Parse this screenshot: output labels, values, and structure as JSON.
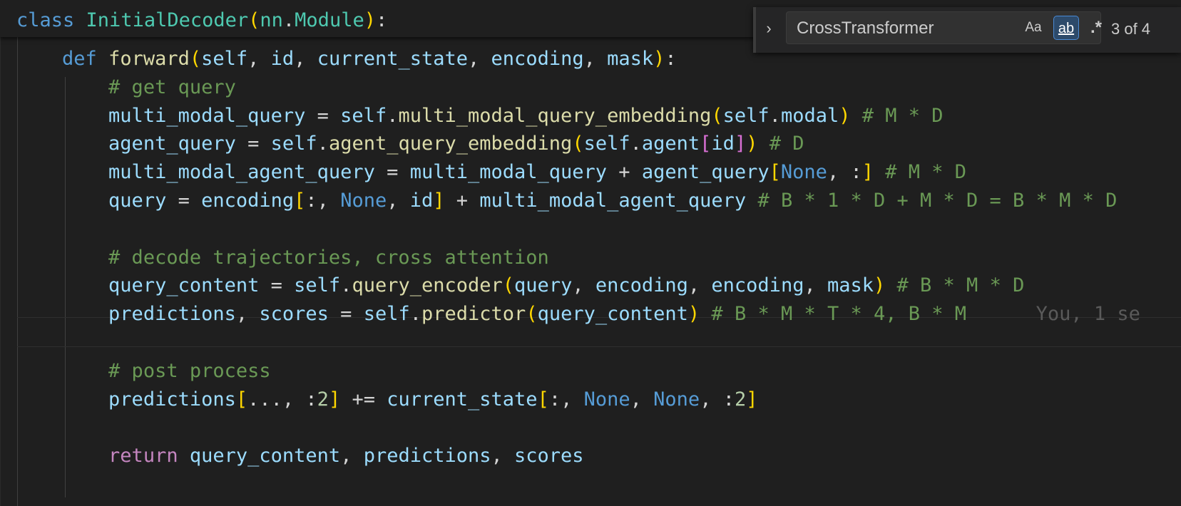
{
  "sticky_header": [
    {
      "t": "class ",
      "c": "kw"
    },
    {
      "t": "InitialDecoder",
      "c": "cls"
    },
    {
      "t": "(",
      "c": "br1"
    },
    {
      "t": "nn",
      "c": "cls"
    },
    {
      "t": ".",
      "c": "txt"
    },
    {
      "t": "Module",
      "c": "cls"
    },
    {
      "t": ")",
      "c": "br1"
    },
    {
      "t": ":",
      "c": "txt"
    }
  ],
  "code_lines": [
    [
      {
        "t": "    ",
        "c": "txt"
      },
      {
        "t": "def ",
        "c": "kw"
      },
      {
        "t": "forward",
        "c": "fn"
      },
      {
        "t": "(",
        "c": "br1"
      },
      {
        "t": "self",
        "c": "var"
      },
      {
        "t": ", ",
        "c": "txt"
      },
      {
        "t": "id",
        "c": "var"
      },
      {
        "t": ", ",
        "c": "txt"
      },
      {
        "t": "current_state",
        "c": "var"
      },
      {
        "t": ", ",
        "c": "txt"
      },
      {
        "t": "encoding",
        "c": "var"
      },
      {
        "t": ", ",
        "c": "txt"
      },
      {
        "t": "mask",
        "c": "var"
      },
      {
        "t": ")",
        "c": "br1"
      },
      {
        "t": ":",
        "c": "txt"
      }
    ],
    [
      {
        "t": "        ",
        "c": "txt"
      },
      {
        "t": "# get query",
        "c": "cmt"
      }
    ],
    [
      {
        "t": "        ",
        "c": "txt"
      },
      {
        "t": "multi_modal_query",
        "c": "var"
      },
      {
        "t": " = ",
        "c": "txt"
      },
      {
        "t": "self",
        "c": "var"
      },
      {
        "t": ".",
        "c": "txt"
      },
      {
        "t": "multi_modal_query_embedding",
        "c": "fn"
      },
      {
        "t": "(",
        "c": "br1"
      },
      {
        "t": "self",
        "c": "var"
      },
      {
        "t": ".",
        "c": "txt"
      },
      {
        "t": "modal",
        "c": "var"
      },
      {
        "t": ")",
        "c": "br1"
      },
      {
        "t": " # M * D",
        "c": "cmt"
      }
    ],
    [
      {
        "t": "        ",
        "c": "txt"
      },
      {
        "t": "agent_query",
        "c": "var"
      },
      {
        "t": " = ",
        "c": "txt"
      },
      {
        "t": "self",
        "c": "var"
      },
      {
        "t": ".",
        "c": "txt"
      },
      {
        "t": "agent_query_embedding",
        "c": "fn"
      },
      {
        "t": "(",
        "c": "br1"
      },
      {
        "t": "self",
        "c": "var"
      },
      {
        "t": ".",
        "c": "txt"
      },
      {
        "t": "agent",
        "c": "var"
      },
      {
        "t": "[",
        "c": "br2"
      },
      {
        "t": "id",
        "c": "var"
      },
      {
        "t": "]",
        "c": "br2"
      },
      {
        "t": ")",
        "c": "br1"
      },
      {
        "t": " # D",
        "c": "cmt"
      }
    ],
    [
      {
        "t": "        ",
        "c": "txt"
      },
      {
        "t": "multi_modal_agent_query",
        "c": "var"
      },
      {
        "t": " = ",
        "c": "txt"
      },
      {
        "t": "multi_modal_query",
        "c": "var"
      },
      {
        "t": " + ",
        "c": "txt"
      },
      {
        "t": "agent_query",
        "c": "var"
      },
      {
        "t": "[",
        "c": "br1"
      },
      {
        "t": "None",
        "c": "kw"
      },
      {
        "t": ", :",
        "c": "txt"
      },
      {
        "t": "]",
        "c": "br1"
      },
      {
        "t": " # M * D",
        "c": "cmt"
      }
    ],
    [
      {
        "t": "        ",
        "c": "txt"
      },
      {
        "t": "query",
        "c": "var"
      },
      {
        "t": " = ",
        "c": "txt"
      },
      {
        "t": "encoding",
        "c": "var"
      },
      {
        "t": "[",
        "c": "br1"
      },
      {
        "t": ":, ",
        "c": "txt"
      },
      {
        "t": "None",
        "c": "kw"
      },
      {
        "t": ", ",
        "c": "txt"
      },
      {
        "t": "id",
        "c": "var"
      },
      {
        "t": "]",
        "c": "br1"
      },
      {
        "t": " + ",
        "c": "txt"
      },
      {
        "t": "multi_modal_agent_query",
        "c": "var"
      },
      {
        "t": " # B * 1 * D + M * D = B * M * D",
        "c": "cmt"
      }
    ],
    [
      {
        "t": "",
        "c": "txt"
      }
    ],
    [
      {
        "t": "        ",
        "c": "txt"
      },
      {
        "t": "# decode trajectories, cross attention",
        "c": "cmt"
      }
    ],
    [
      {
        "t": "        ",
        "c": "txt"
      },
      {
        "t": "query_content",
        "c": "var"
      },
      {
        "t": " = ",
        "c": "txt"
      },
      {
        "t": "self",
        "c": "var"
      },
      {
        "t": ".",
        "c": "txt"
      },
      {
        "t": "query_encoder",
        "c": "fn"
      },
      {
        "t": "(",
        "c": "br1"
      },
      {
        "t": "query",
        "c": "var"
      },
      {
        "t": ", ",
        "c": "txt"
      },
      {
        "t": "encoding",
        "c": "var"
      },
      {
        "t": ", ",
        "c": "txt"
      },
      {
        "t": "encoding",
        "c": "var"
      },
      {
        "t": ", ",
        "c": "txt"
      },
      {
        "t": "mask",
        "c": "var"
      },
      {
        "t": ")",
        "c": "br1"
      },
      {
        "t": " # B * M * D",
        "c": "cmt"
      }
    ],
    [
      {
        "t": "        ",
        "c": "txt"
      },
      {
        "t": "predictions",
        "c": "var"
      },
      {
        "t": ", ",
        "c": "txt"
      },
      {
        "t": "scores",
        "c": "var"
      },
      {
        "t": " = ",
        "c": "txt"
      },
      {
        "t": "self",
        "c": "var"
      },
      {
        "t": ".",
        "c": "txt"
      },
      {
        "t": "predictor",
        "c": "fn"
      },
      {
        "t": "(",
        "c": "br1"
      },
      {
        "t": "query_content",
        "c": "var"
      },
      {
        "t": ")",
        "c": "br1"
      },
      {
        "t": " # B * M * T * 4, B * M",
        "c": "cmt"
      },
      {
        "t": "      You, 1 se",
        "c": "blame"
      }
    ],
    [
      {
        "t": "",
        "c": "txt"
      }
    ],
    [
      {
        "t": "        ",
        "c": "txt"
      },
      {
        "t": "# post process",
        "c": "cmt"
      }
    ],
    [
      {
        "t": "        ",
        "c": "txt"
      },
      {
        "t": "predictions",
        "c": "var"
      },
      {
        "t": "[",
        "c": "br1"
      },
      {
        "t": "..., :",
        "c": "txt"
      },
      {
        "t": "2",
        "c": "num"
      },
      {
        "t": "]",
        "c": "br1"
      },
      {
        "t": " += ",
        "c": "txt"
      },
      {
        "t": "current_state",
        "c": "var"
      },
      {
        "t": "[",
        "c": "br1"
      },
      {
        "t": ":, ",
        "c": "txt"
      },
      {
        "t": "None",
        "c": "kw"
      },
      {
        "t": ", ",
        "c": "txt"
      },
      {
        "t": "None",
        "c": "kw"
      },
      {
        "t": ", :",
        "c": "txt"
      },
      {
        "t": "2",
        "c": "num"
      },
      {
        "t": "]",
        "c": "br1"
      }
    ],
    [
      {
        "t": "",
        "c": "txt"
      }
    ],
    [
      {
        "t": "        ",
        "c": "txt"
      },
      {
        "t": "return",
        "c": "ctl"
      },
      {
        "t": " ",
        "c": "txt"
      },
      {
        "t": "query_content",
        "c": "var"
      },
      {
        "t": ", ",
        "c": "txt"
      },
      {
        "t": "predictions",
        "c": "var"
      },
      {
        "t": ", ",
        "c": "txt"
      },
      {
        "t": "scores",
        "c": "var"
      }
    ]
  ],
  "find_widget": {
    "toggle_icon": "chevron-right-icon",
    "toggle_glyph": "›",
    "query": "CrossTransformer",
    "match_case_label": "Aa",
    "whole_word_label": "ab",
    "regex_label": ".*",
    "match_count": "3 of 4"
  }
}
